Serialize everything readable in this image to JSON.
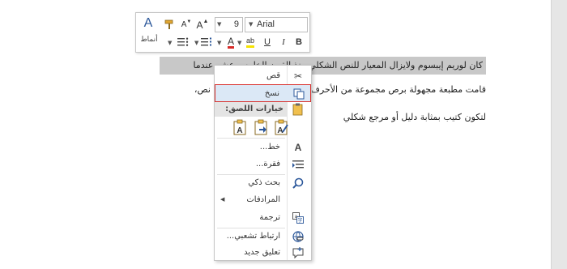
{
  "document": {
    "line1": "كان لوريم إيبسوم ولايزال المعيار للنص الشكلي منذ القرن الخامس عشر عندما",
    "line2": "قامت مطبعة مجهولة برص مجموعة من الأحرف بشكل عشوائي أخذتها من نص،",
    "line3": "لتكون كتيب بمثابة دليل أو مرجع شكلي"
  },
  "toolbar": {
    "font_name": "Arial",
    "font_size": "9",
    "styles_label": "أنماط",
    "bold": "B",
    "italic": "I",
    "underline": "U",
    "font_color_glyph": "A",
    "highlight_glyph": "ab",
    "grow_glyph": "A",
    "shrink_glyph": "A",
    "styles_glyph": "A",
    "font_color": "#d62a27",
    "highlight_color": "#f6e300"
  },
  "context_menu": {
    "cut": "قص",
    "copy": "نسخ",
    "paste_options": "خيارات اللصق:",
    "font": "خط...",
    "paragraph": "فقرة...",
    "smart_lookup": "بحث ذكي",
    "synonyms": "المرادفات",
    "translate": "ترجمة",
    "link": "ارتباط تشعبي...",
    "new_comment": "تعليق جديد"
  }
}
